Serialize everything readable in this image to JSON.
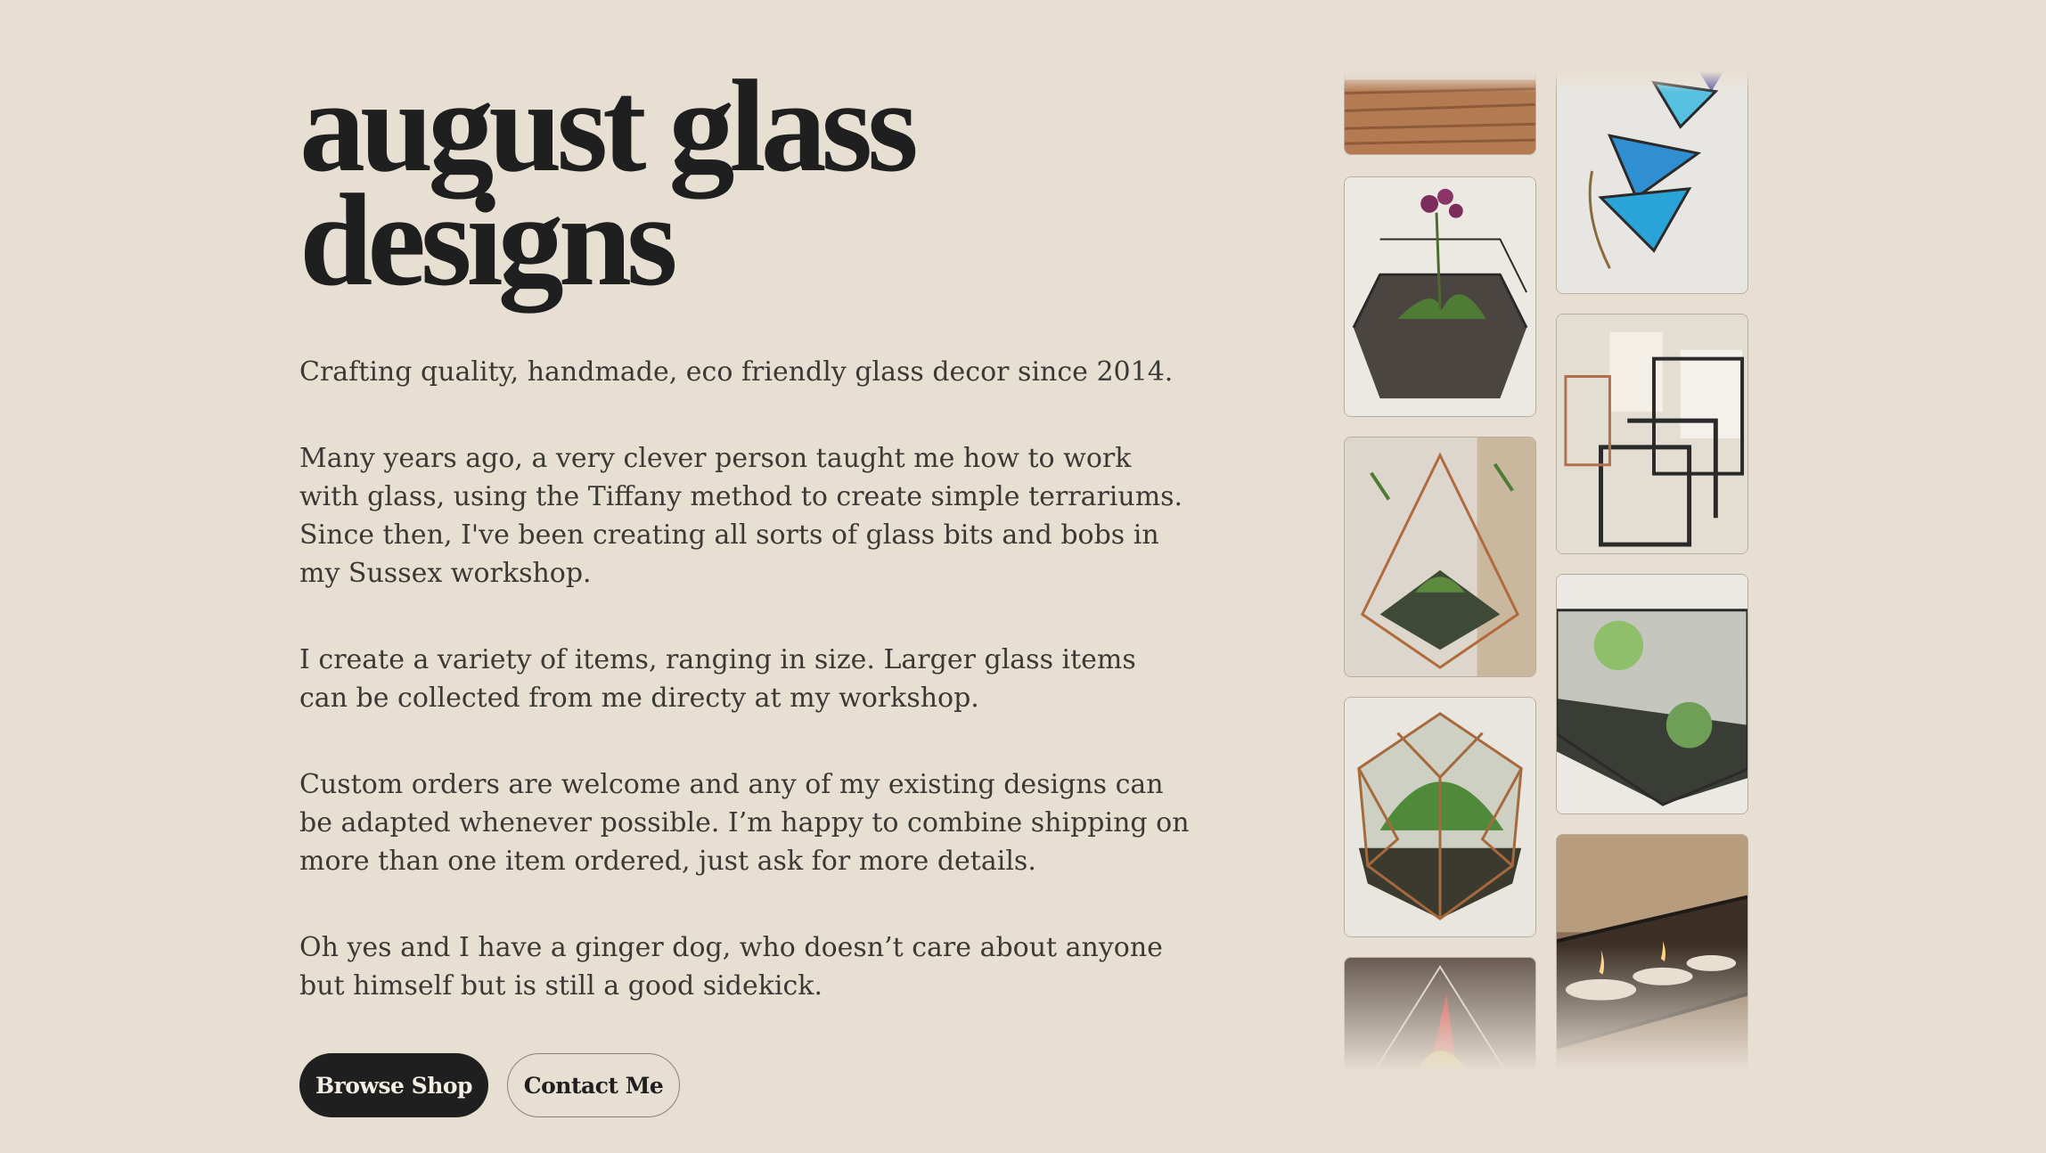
{
  "hero": {
    "title_line1": "august glass",
    "title_line2": "designs",
    "paragraphs": [
      "Crafting quality, handmade, eco friendly glass decor since 2014.",
      "Many years ago, a very clever person taught me how to work with glass, using the Tiffany method to create simple terrariums. Since then, I've been creating all sorts of glass bits and bobs in my Sussex workshop.",
      "I create a variety of items, ranging in size. Larger glass items can be collected from me directy at my workshop.",
      "Custom orders are welcome and any of my existing designs can be adapted whenever possible. I’m happy to combine shipping on more than one item ordered, just ask for more details.",
      "Oh yes and I have a ginger dog, who doesn’t care about anyone but himself but is still a good sidekick."
    ]
  },
  "actions": {
    "browse_label": "Browse Shop",
    "contact_label": "Contact Me"
  },
  "gallery": {
    "images": [
      "wooden-surface-photo",
      "orchid-hexagon-terrarium-photo",
      "copper-geometric-terrarium-photo",
      "dodecahedron-terrarium-photo",
      "red-plant-pyramid-photo",
      "blue-stained-glass-triangles-photo",
      "glass-cube-candle-holders-photo",
      "succulent-boat-terrarium-photo",
      "tealight-candle-holder-photo"
    ]
  }
}
